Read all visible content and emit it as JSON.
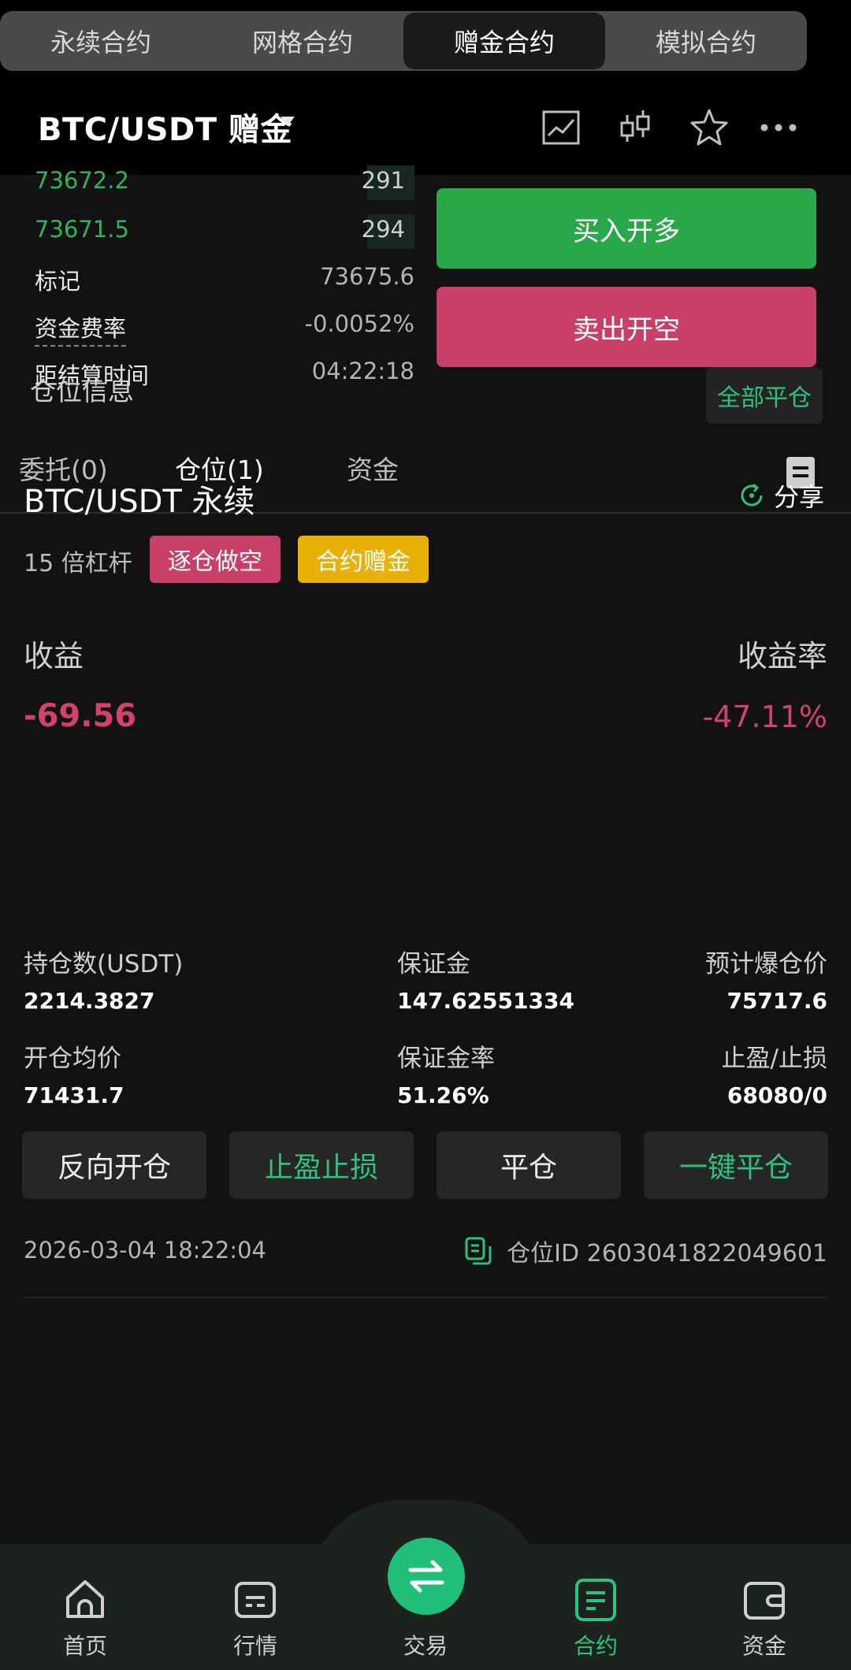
{
  "segments": [
    "永续合约",
    "网格合约",
    "赠金合约",
    "模拟合约"
  ],
  "pair": {
    "title": "BTC/USDT  赠金"
  },
  "orderbook": [
    {
      "price": "73672.2",
      "qty": "291"
    },
    {
      "price": "73671.5",
      "qty": "294"
    }
  ],
  "info": {
    "mark_label": "标记",
    "mark_value": "73675.6",
    "funding_label": "资金费率",
    "funding_value": "-0.0052%",
    "settle_label": "距结算时间",
    "settle_value": "04:22:18"
  },
  "actions": {
    "buy": "买入开多",
    "sell": "卖出开空"
  },
  "tabs": [
    "委托(0)",
    "仓位(1)",
    "资金"
  ],
  "position_section": {
    "title": "仓位信息",
    "close_all": "全部平仓"
  },
  "position": {
    "symbol": "BTC/USDT 永续",
    "share": "分享",
    "leverage": "15 倍杠杆",
    "side_badge": "逐仓做空",
    "bonus_badge": "合约赠金",
    "pnl_label": "收益",
    "roe_label": "收益率",
    "pnl": "-69.56",
    "roe": "-47.11%",
    "stats": {
      "size_label": "持仓数(USDT)",
      "size": "2214.3827",
      "margin_label": "保证金",
      "margin": "147.62551334",
      "liq_label": "预计爆仓价",
      "liq": "75717.6",
      "entry_label": "开仓均价",
      "entry": "71431.7",
      "margin_rate_label": "保证金率",
      "margin_rate": "51.26%",
      "tpsl_label": "止盈/止损",
      "tpsl": "68080/0"
    },
    "buttons": [
      "反向开仓",
      "止盈止损",
      "平仓",
      "一键平仓"
    ],
    "timestamp": "2026-03-04 18:22:04",
    "position_id": "仓位ID 2603041822049601"
  },
  "nav": [
    "首页",
    "行情",
    "交易",
    "合约",
    "资金"
  ],
  "colors": {
    "green": "#2ec27e",
    "buy": "#29a84a",
    "sell": "#c83f68",
    "bonus": "#e9b008"
  }
}
